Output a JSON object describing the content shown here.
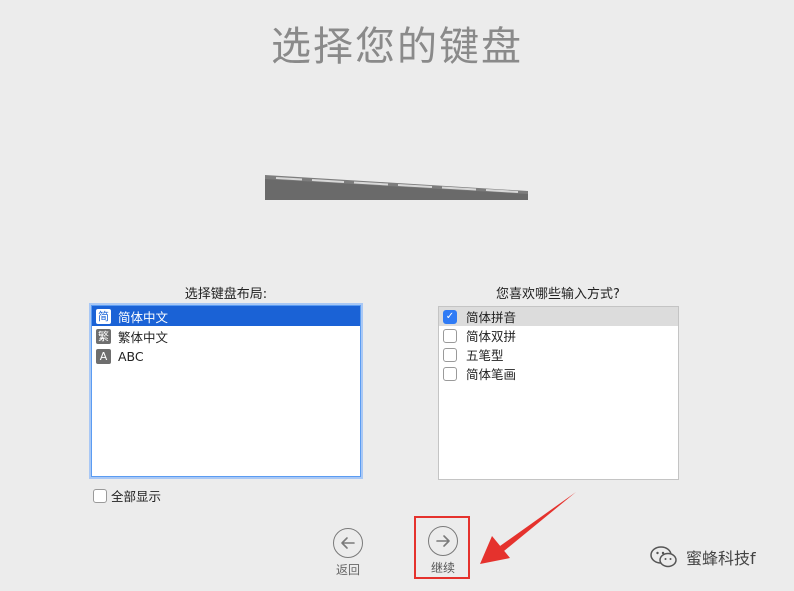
{
  "title": "选择您的键盘",
  "layout_section": {
    "label": "选择键盘布局:",
    "items": [
      {
        "badge": "简",
        "label": "简体中文",
        "selected": true
      },
      {
        "badge": "繁",
        "label": "繁体中文",
        "selected": false
      },
      {
        "badge": "A",
        "label": "ABC",
        "selected": false
      }
    ]
  },
  "method_section": {
    "label": "您喜欢哪些输入方式?",
    "items": [
      {
        "label": "简体拼音",
        "checked": true
      },
      {
        "label": "简体双拼",
        "checked": false
      },
      {
        "label": "五笔型",
        "checked": false
      },
      {
        "label": "简体笔画",
        "checked": false
      }
    ]
  },
  "show_all": {
    "label": "全部显示",
    "checked": false
  },
  "nav": {
    "back_label": "返回",
    "continue_label": "继续"
  },
  "watermark": {
    "text": "蜜蜂科技f"
  },
  "colors": {
    "accent": "#1a62d6",
    "highlight_box": "#e5322d"
  }
}
